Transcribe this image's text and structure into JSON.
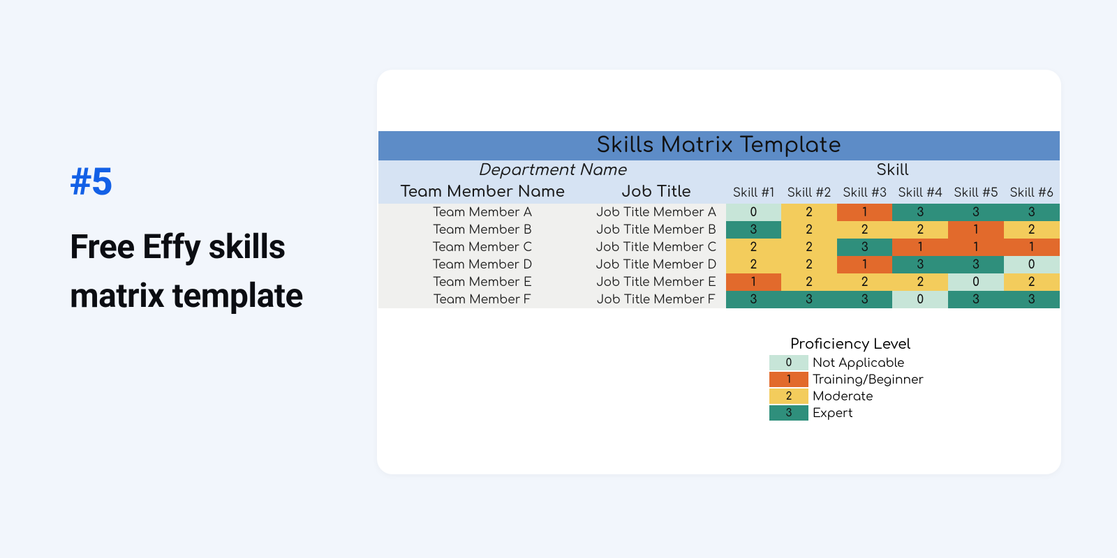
{
  "left": {
    "number": "#5",
    "title": "Free Effy skills matrix template"
  },
  "matrix": {
    "banner": "Skills Matrix Template",
    "group_left": "Department Name",
    "group_right": "Skill",
    "header_name": "Team Member Name",
    "header_job": "Job Title",
    "skill_headers": [
      "Skill #1",
      "Skill #2",
      "Skill #3",
      "Skill #4",
      "Skill #5",
      "Skill #6"
    ],
    "rows": [
      {
        "name": "Team Member A",
        "job": "Job Title Member A",
        "skills": [
          0,
          2,
          1,
          3,
          3,
          3
        ]
      },
      {
        "name": "Team Member B",
        "job": "Job Title Member B",
        "skills": [
          3,
          2,
          2,
          2,
          1,
          2
        ]
      },
      {
        "name": "Team Member C",
        "job": "Job Title Member C",
        "skills": [
          2,
          2,
          3,
          1,
          1,
          1
        ]
      },
      {
        "name": "Team Member D",
        "job": "Job Title Member D",
        "skills": [
          2,
          2,
          1,
          3,
          3,
          0
        ]
      },
      {
        "name": "Team Member E",
        "job": "Job Title Member E",
        "skills": [
          1,
          2,
          2,
          2,
          0,
          2
        ]
      },
      {
        "name": "Team Member F",
        "job": "Job Title Member F",
        "skills": [
          3,
          3,
          3,
          0,
          3,
          3
        ]
      }
    ]
  },
  "legend": {
    "title": "Proficiency Level",
    "items": [
      {
        "value": 0,
        "label": "Not Applicable"
      },
      {
        "value": 1,
        "label": "Training/Beginner"
      },
      {
        "value": 2,
        "label": "Moderate"
      },
      {
        "value": 3,
        "label": "Expert"
      }
    ]
  },
  "colors": {
    "0": "#c7e5d8",
    "1": "#e26a2c",
    "2": "#f3cc5c",
    "3": "#2f8f7c"
  }
}
